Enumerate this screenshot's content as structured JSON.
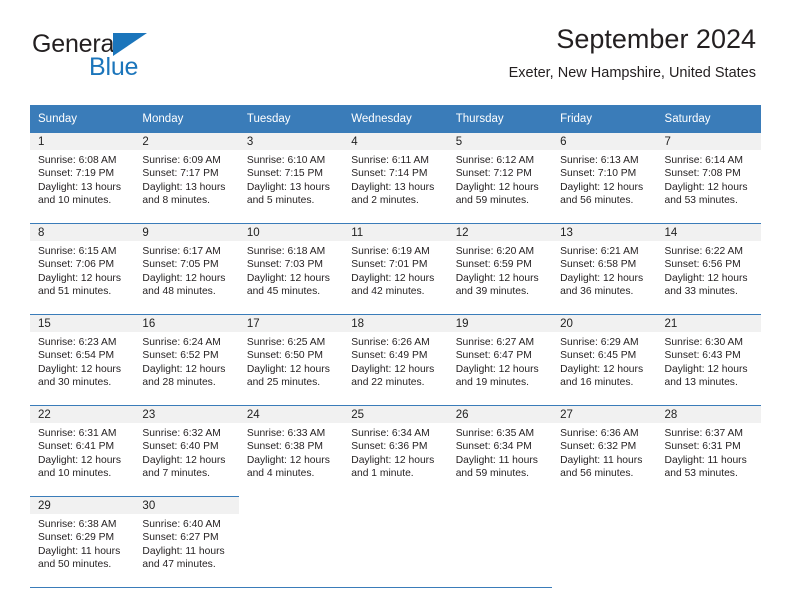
{
  "brand": {
    "name_top": "General",
    "name_bottom": "Blue",
    "accent_color": "#1b75bb",
    "triangle_icon": "triangle-icon"
  },
  "header": {
    "title": "September 2024",
    "subtitle": "Exeter, New Hampshire, United States"
  },
  "calendar": {
    "header_bg": "#3a7cb9",
    "daynum_bg": "#f1f1f1",
    "weekdays": [
      "Sunday",
      "Monday",
      "Tuesday",
      "Wednesday",
      "Thursday",
      "Friday",
      "Saturday"
    ],
    "weeks": [
      [
        {
          "day": "1",
          "sunrise": "Sunrise: 6:08 AM",
          "sunset": "Sunset: 7:19 PM",
          "daylight1": "Daylight: 13 hours",
          "daylight2": "and 10 minutes."
        },
        {
          "day": "2",
          "sunrise": "Sunrise: 6:09 AM",
          "sunset": "Sunset: 7:17 PM",
          "daylight1": "Daylight: 13 hours",
          "daylight2": "and 8 minutes."
        },
        {
          "day": "3",
          "sunrise": "Sunrise: 6:10 AM",
          "sunset": "Sunset: 7:15 PM",
          "daylight1": "Daylight: 13 hours",
          "daylight2": "and 5 minutes."
        },
        {
          "day": "4",
          "sunrise": "Sunrise: 6:11 AM",
          "sunset": "Sunset: 7:14 PM",
          "daylight1": "Daylight: 13 hours",
          "daylight2": "and 2 minutes."
        },
        {
          "day": "5",
          "sunrise": "Sunrise: 6:12 AM",
          "sunset": "Sunset: 7:12 PM",
          "daylight1": "Daylight: 12 hours",
          "daylight2": "and 59 minutes."
        },
        {
          "day": "6",
          "sunrise": "Sunrise: 6:13 AM",
          "sunset": "Sunset: 7:10 PM",
          "daylight1": "Daylight: 12 hours",
          "daylight2": "and 56 minutes."
        },
        {
          "day": "7",
          "sunrise": "Sunrise: 6:14 AM",
          "sunset": "Sunset: 7:08 PM",
          "daylight1": "Daylight: 12 hours",
          "daylight2": "and 53 minutes."
        }
      ],
      [
        {
          "day": "8",
          "sunrise": "Sunrise: 6:15 AM",
          "sunset": "Sunset: 7:06 PM",
          "daylight1": "Daylight: 12 hours",
          "daylight2": "and 51 minutes."
        },
        {
          "day": "9",
          "sunrise": "Sunrise: 6:17 AM",
          "sunset": "Sunset: 7:05 PM",
          "daylight1": "Daylight: 12 hours",
          "daylight2": "and 48 minutes."
        },
        {
          "day": "10",
          "sunrise": "Sunrise: 6:18 AM",
          "sunset": "Sunset: 7:03 PM",
          "daylight1": "Daylight: 12 hours",
          "daylight2": "and 45 minutes."
        },
        {
          "day": "11",
          "sunrise": "Sunrise: 6:19 AM",
          "sunset": "Sunset: 7:01 PM",
          "daylight1": "Daylight: 12 hours",
          "daylight2": "and 42 minutes."
        },
        {
          "day": "12",
          "sunrise": "Sunrise: 6:20 AM",
          "sunset": "Sunset: 6:59 PM",
          "daylight1": "Daylight: 12 hours",
          "daylight2": "and 39 minutes."
        },
        {
          "day": "13",
          "sunrise": "Sunrise: 6:21 AM",
          "sunset": "Sunset: 6:58 PM",
          "daylight1": "Daylight: 12 hours",
          "daylight2": "and 36 minutes."
        },
        {
          "day": "14",
          "sunrise": "Sunrise: 6:22 AM",
          "sunset": "Sunset: 6:56 PM",
          "daylight1": "Daylight: 12 hours",
          "daylight2": "and 33 minutes."
        }
      ],
      [
        {
          "day": "15",
          "sunrise": "Sunrise: 6:23 AM",
          "sunset": "Sunset: 6:54 PM",
          "daylight1": "Daylight: 12 hours",
          "daylight2": "and 30 minutes."
        },
        {
          "day": "16",
          "sunrise": "Sunrise: 6:24 AM",
          "sunset": "Sunset: 6:52 PM",
          "daylight1": "Daylight: 12 hours",
          "daylight2": "and 28 minutes."
        },
        {
          "day": "17",
          "sunrise": "Sunrise: 6:25 AM",
          "sunset": "Sunset: 6:50 PM",
          "daylight1": "Daylight: 12 hours",
          "daylight2": "and 25 minutes."
        },
        {
          "day": "18",
          "sunrise": "Sunrise: 6:26 AM",
          "sunset": "Sunset: 6:49 PM",
          "daylight1": "Daylight: 12 hours",
          "daylight2": "and 22 minutes."
        },
        {
          "day": "19",
          "sunrise": "Sunrise: 6:27 AM",
          "sunset": "Sunset: 6:47 PM",
          "daylight1": "Daylight: 12 hours",
          "daylight2": "and 19 minutes."
        },
        {
          "day": "20",
          "sunrise": "Sunrise: 6:29 AM",
          "sunset": "Sunset: 6:45 PM",
          "daylight1": "Daylight: 12 hours",
          "daylight2": "and 16 minutes."
        },
        {
          "day": "21",
          "sunrise": "Sunrise: 6:30 AM",
          "sunset": "Sunset: 6:43 PM",
          "daylight1": "Daylight: 12 hours",
          "daylight2": "and 13 minutes."
        }
      ],
      [
        {
          "day": "22",
          "sunrise": "Sunrise: 6:31 AM",
          "sunset": "Sunset: 6:41 PM",
          "daylight1": "Daylight: 12 hours",
          "daylight2": "and 10 minutes."
        },
        {
          "day": "23",
          "sunrise": "Sunrise: 6:32 AM",
          "sunset": "Sunset: 6:40 PM",
          "daylight1": "Daylight: 12 hours",
          "daylight2": "and 7 minutes."
        },
        {
          "day": "24",
          "sunrise": "Sunrise: 6:33 AM",
          "sunset": "Sunset: 6:38 PM",
          "daylight1": "Daylight: 12 hours",
          "daylight2": "and 4 minutes."
        },
        {
          "day": "25",
          "sunrise": "Sunrise: 6:34 AM",
          "sunset": "Sunset: 6:36 PM",
          "daylight1": "Daylight: 12 hours",
          "daylight2": "and 1 minute."
        },
        {
          "day": "26",
          "sunrise": "Sunrise: 6:35 AM",
          "sunset": "Sunset: 6:34 PM",
          "daylight1": "Daylight: 11 hours",
          "daylight2": "and 59 minutes."
        },
        {
          "day": "27",
          "sunrise": "Sunrise: 6:36 AM",
          "sunset": "Sunset: 6:32 PM",
          "daylight1": "Daylight: 11 hours",
          "daylight2": "and 56 minutes."
        },
        {
          "day": "28",
          "sunrise": "Sunrise: 6:37 AM",
          "sunset": "Sunset: 6:31 PM",
          "daylight1": "Daylight: 11 hours",
          "daylight2": "and 53 minutes."
        }
      ],
      [
        {
          "day": "29",
          "sunrise": "Sunrise: 6:38 AM",
          "sunset": "Sunset: 6:29 PM",
          "daylight1": "Daylight: 11 hours",
          "daylight2": "and 50 minutes."
        },
        {
          "day": "30",
          "sunrise": "Sunrise: 6:40 AM",
          "sunset": "Sunset: 6:27 PM",
          "daylight1": "Daylight: 11 hours",
          "daylight2": "and 47 minutes."
        }
      ]
    ]
  }
}
